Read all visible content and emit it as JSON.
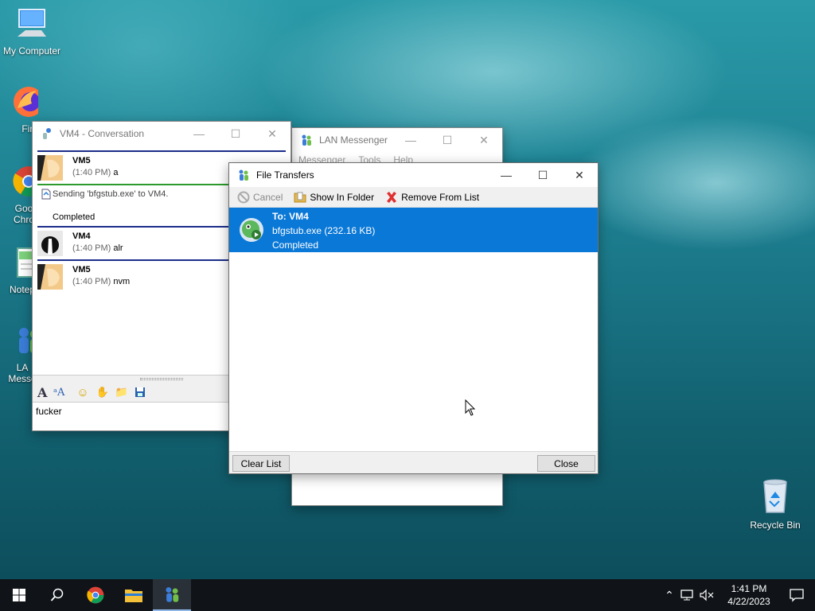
{
  "desktop": {
    "icons": [
      {
        "label": "My Computer"
      },
      {
        "label": "Fire"
      },
      {
        "label": "Goo Chro"
      },
      {
        "label": "Notep"
      },
      {
        "label": "LA Messe"
      },
      {
        "label": "Recycle Bin"
      }
    ]
  },
  "conversation": {
    "title": "VM4 - Conversation",
    "messages": [
      {
        "sender": "VM5",
        "time": "(1:40 PM)",
        "text": "a"
      },
      {
        "sender": "VM4",
        "time": "(1:40 PM)",
        "text": "alr"
      },
      {
        "sender": "VM5",
        "time": "(1:40 PM)",
        "text": "nvm"
      }
    ],
    "file_notice": "Sending 'bfgstub.exe' to VM4.",
    "file_status": "Completed",
    "input_value": "fucker",
    "format_icons": [
      "font-icon",
      "font-style-icon",
      "smiley-icon",
      "nudge-icon",
      "send-file-icon",
      "save-icon"
    ]
  },
  "messenger": {
    "title": "LAN Messenger",
    "menu": [
      "Messenger",
      "Tools",
      "Help"
    ]
  },
  "transfers": {
    "title": "File Transfers",
    "toolbar": {
      "cancel": "Cancel",
      "show_in_folder": "Show In Folder",
      "remove": "Remove From List"
    },
    "items": [
      {
        "to": "To: VM4",
        "file": "bfgstub.exe (232.16 KB)",
        "status": "Completed"
      }
    ],
    "clear_list": "Clear List",
    "close": "Close"
  },
  "taskbar": {
    "time": "1:41 PM",
    "date": "4/22/2023"
  },
  "colors": {
    "selection": "#0a78d7",
    "taskbar": "#101418",
    "chat_separator": "#1b2d8a"
  }
}
